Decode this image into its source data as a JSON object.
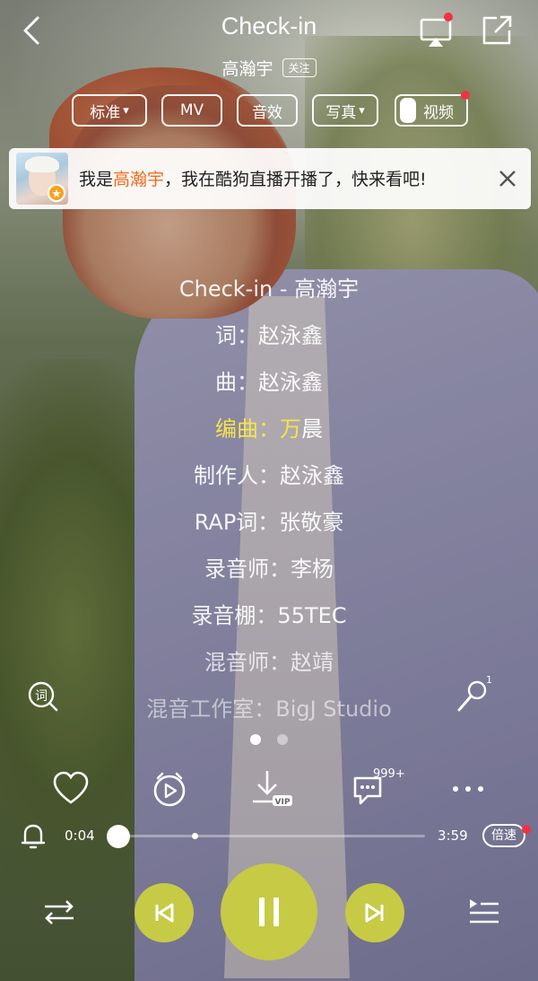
{
  "header": {
    "title": "Check-in",
    "artist": "高瀚宇",
    "follow_label": "关注",
    "chips": [
      {
        "label": "标准",
        "has_dropdown": true
      },
      {
        "label": "MV",
        "has_dropdown": false
      },
      {
        "label": "音效",
        "has_dropdown": false
      },
      {
        "label": "写真",
        "has_dropdown": true
      }
    ],
    "video_toggle_label": "视频",
    "icons": {
      "back": "chevron-left-icon",
      "cast": "screen-cast-icon",
      "share": "share-out-icon"
    },
    "notification_color": "#f33044"
  },
  "live_banner": {
    "prefix": "我是",
    "name": "高瀚宇",
    "suffix": "，我在酷狗直播开播了，快来看吧!",
    "highlight_color": "#f26b1d"
  },
  "lyrics": [
    {
      "text": "Check-in - 高瀚宇",
      "state": "normal"
    },
    {
      "text": "词：赵泳鑫",
      "state": "normal"
    },
    {
      "text": "曲：赵泳鑫",
      "state": "normal"
    },
    {
      "sung": "编曲：万",
      "rest": "晨",
      "state": "active"
    },
    {
      "text": "制作人：赵泳鑫",
      "state": "normal"
    },
    {
      "text": "RAP词：张敬豪",
      "state": "normal"
    },
    {
      "text": "录音师：李杨",
      "state": "normal"
    },
    {
      "text": "录音棚：55TEC",
      "state": "normal"
    },
    {
      "text": "混音师：赵靖",
      "state": "fade1"
    },
    {
      "text": "混音工作室：BigJ Studio",
      "state": "fade2"
    }
  ],
  "lyric_button_label": "词",
  "mic_badge": "1",
  "page_dots": {
    "count": 2,
    "active": 0
  },
  "actions": {
    "comment_count": "999+",
    "download_badge": "VIP",
    "icons": [
      "heart-icon",
      "radio-clock-icon",
      "download-vip-icon",
      "comment-icon",
      "more-icon"
    ]
  },
  "progress": {
    "current": "0:04",
    "total": "3:59",
    "played_fraction": 0.017,
    "buffered_fraction": 0.26,
    "speed_label": "倍速"
  },
  "player": {
    "accent_color": "#c6ca45",
    "icons": [
      "shuffle-icon",
      "previous-icon",
      "pause-icon",
      "next-icon",
      "playlist-icon"
    ]
  }
}
